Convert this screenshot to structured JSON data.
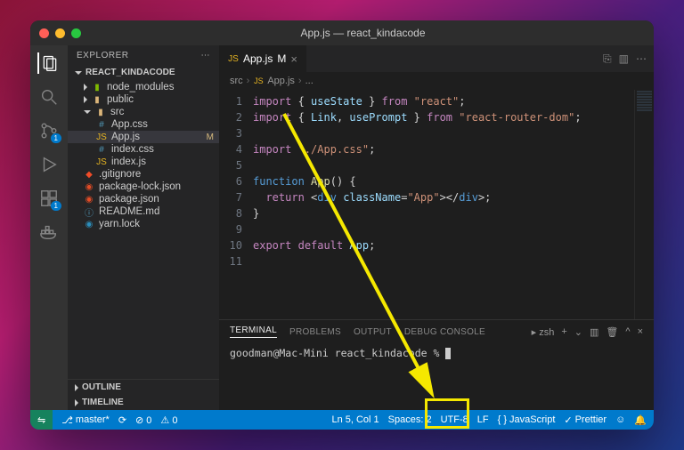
{
  "title": "App.js — react_kindacode",
  "explorer": {
    "title": "EXPLORER",
    "project": "REACT_KINDACODE",
    "tree": {
      "node_modules": "node_modules",
      "public": "public",
      "src": "src",
      "app_css": "App.css",
      "app_js": "App.js",
      "app_js_mod": "M",
      "index_css": "index.css",
      "index_js": "index.js",
      "gitignore": ".gitignore",
      "pkg_lock": "package-lock.json",
      "pkg": "package.json",
      "readme": "README.md",
      "yarn": "yarn.lock"
    },
    "outline": "OUTLINE",
    "timeline": "TIMELINE"
  },
  "tabbar": {
    "file_icon": "JS",
    "file": "App.js",
    "modified": "M",
    "close": "×"
  },
  "breadcrumbs": {
    "a": "src",
    "b": "App.js",
    "c": "..."
  },
  "code": {
    "lines": [
      "1",
      "2",
      "3",
      "4",
      "5",
      "6",
      "7",
      "8",
      "9",
      "10",
      "11"
    ],
    "l1_import": "import",
    "l1_use": "useState",
    "l1_from": "from",
    "l1_react": "\"react\"",
    "l2_link": "Link",
    "l2_prompt": "usePrompt",
    "l2_pkg": "\"react-router-dom\"",
    "l4_css": "\"./App.css\"",
    "l6_fn": "function",
    "l6_app": "App",
    "l7_ret": "return",
    "l7_div": "div",
    "l7_cn": "className",
    "l7_val": "\"App\"",
    "l10_exp": "export",
    "l10_def": "default",
    "l10_app": "App"
  },
  "panel": {
    "terminal": "TERMINAL",
    "problems": "PROBLEMS",
    "output": "OUTPUT",
    "debug": "DEBUG CONSOLE",
    "shell": "zsh",
    "prompt": "goodman@Mac-Mini react_kindacode % "
  },
  "status": {
    "branch": "master*",
    "sync": "⟳",
    "errors": "⊘ 0",
    "warnings": "⚠ 0",
    "ln": "Ln 5, Col 1",
    "spaces": "Spaces: 2",
    "enc": "UTF-8",
    "eol": "LF",
    "lang": "JavaScript",
    "prettier": "Prettier",
    "feedback": "☺",
    "bell": "🔔"
  },
  "activity_badges": {
    "scm": "1",
    "ext": "1"
  }
}
